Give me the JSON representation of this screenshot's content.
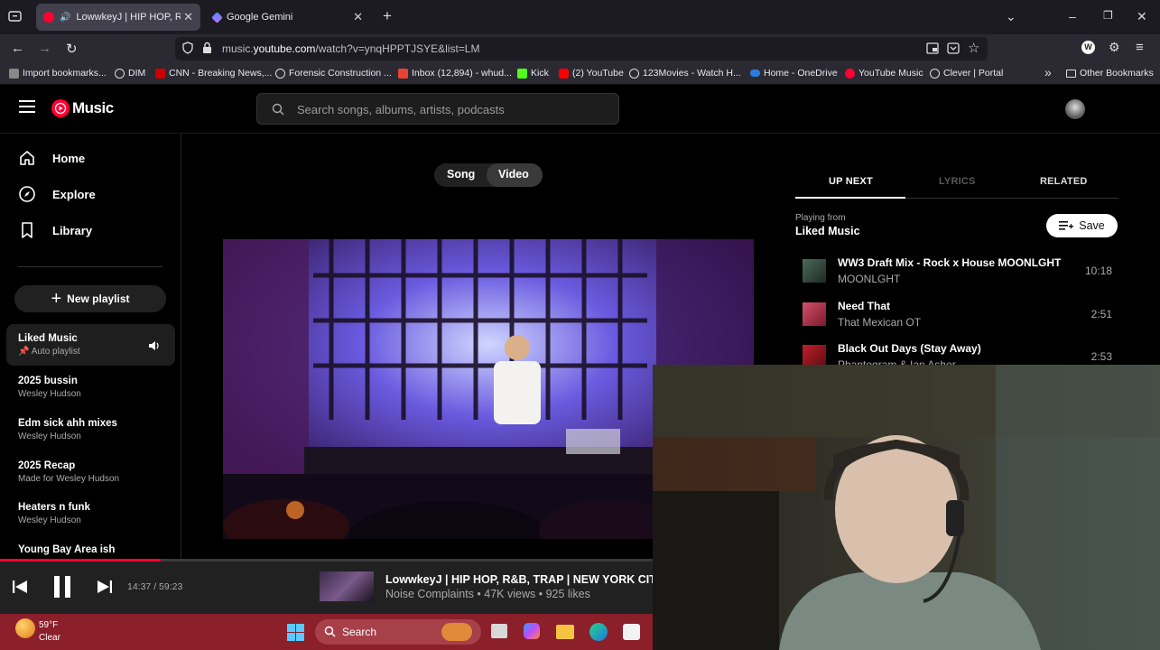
{
  "tabs": [
    {
      "title": "LowwkeyJ | HIP HOP, R&B,",
      "active": true
    },
    {
      "title": "Google Gemini",
      "active": false
    }
  ],
  "address": {
    "prefix": "music.",
    "domain": "youtube.com",
    "path": "/watch?v=ynqHPPTJSYE&list=LM"
  },
  "bookmarks": [
    "Import bookmarks...",
    "DIM",
    "CNN - Breaking News,...",
    "Forensic Construction ...",
    "Inbox (12,894) - whud...",
    "Kick",
    "(2) YouTube",
    "123Movies - Watch H...",
    "Home - OneDrive",
    "YouTube Music",
    "Clever | Portal"
  ],
  "other_bookmarks": "Other Bookmarks",
  "yt": {
    "logo": "Music",
    "search_placeholder": "Search songs, albums, artists, podcasts"
  },
  "nav": {
    "home": "Home",
    "explore": "Explore",
    "library": "Library",
    "new_playlist": "New playlist"
  },
  "playlists": [
    {
      "title": "Liked Music",
      "subtitle": "Auto playlist"
    },
    {
      "title": "2025 bussin",
      "subtitle": "Wesley Hudson"
    },
    {
      "title": "Edm sick ahh mixes",
      "subtitle": "Wesley Hudson"
    },
    {
      "title": "2025 Recap",
      "subtitle": "Made for Wesley Hudson"
    },
    {
      "title": "Heaters n funk",
      "subtitle": "Wesley Hudson"
    },
    {
      "title": "Young Bay Area ish",
      "subtitle": ""
    }
  ],
  "toggle": {
    "song": "Song",
    "video": "Video"
  },
  "panel": {
    "tabs": [
      "UP NEXT",
      "LYRICS",
      "RELATED"
    ],
    "playing_from_label": "Playing from",
    "playing_from": "Liked Music",
    "save": "Save"
  },
  "queue": [
    {
      "title": "WW3 Draft Mix - Rock x House MOONLGHT",
      "artist": "MOONLGHT",
      "duration": "10:18"
    },
    {
      "title": "Need That",
      "artist": "That Mexican OT",
      "duration": "2:51"
    },
    {
      "title": "Black Out Days (Stay Away)",
      "artist": "Phantogram & Ian Asher",
      "duration": "2:53"
    }
  ],
  "player": {
    "time": "14:37 / 59:23",
    "progress": 0.246,
    "title": "LowwkeyJ | HIP HOP, R&B, TRAP | NEW YORK CIT",
    "meta": "Noise Complaints • 47K views • 925 likes"
  },
  "taskbar": {
    "temp": "59°F",
    "cond": "Clear",
    "search": "Search"
  },
  "colors": {
    "accent": "#ff0033",
    "taskbar": "#8b1f2a"
  }
}
